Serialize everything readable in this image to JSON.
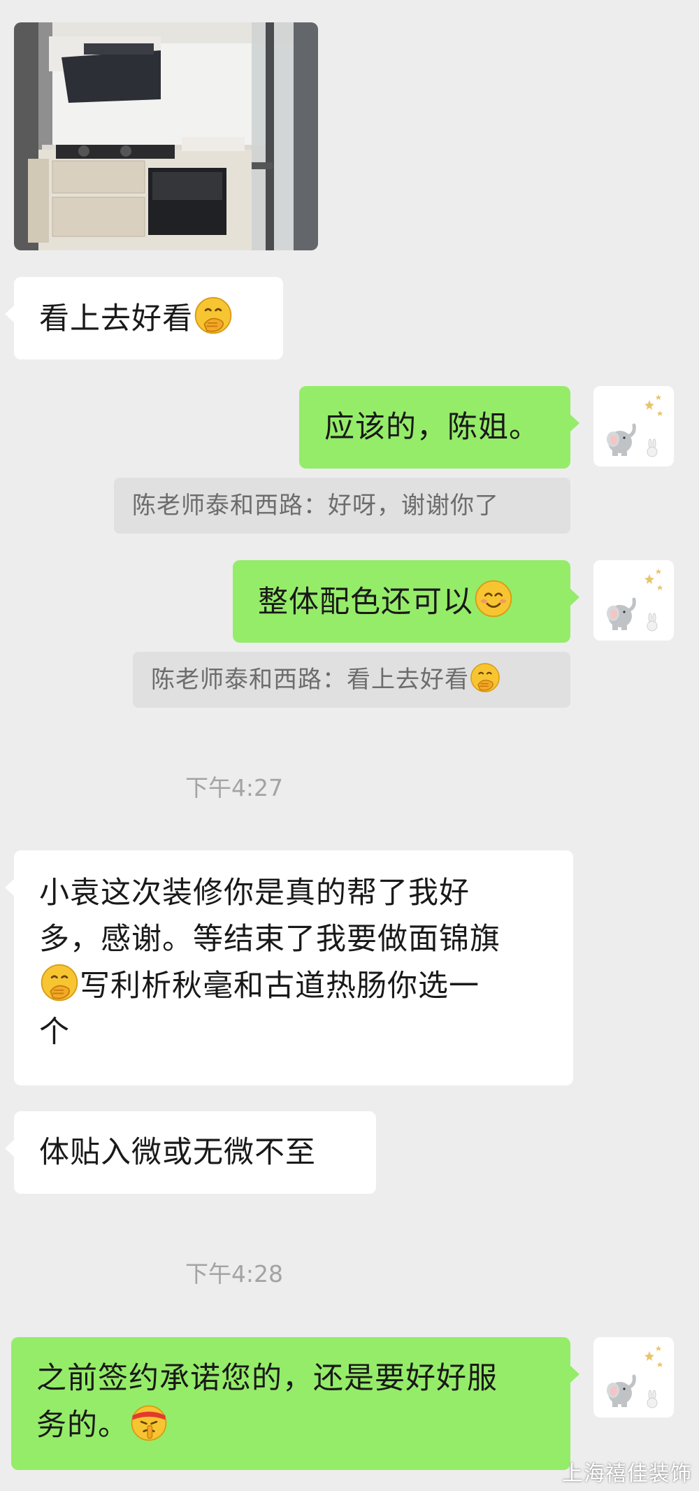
{
  "chat": {
    "photo": {
      "alt": "kitchen-photo"
    },
    "messages": {
      "m1": {
        "text": "看上去好看"
      },
      "m2": {
        "text": "应该的，陈姐。"
      },
      "q1": {
        "text": "陈老师泰和西路：好呀，谢谢你了"
      },
      "m3": {
        "text": "整体配色还可以"
      },
      "q2": {
        "text": "陈老师泰和西路：看上去好看"
      },
      "t1": {
        "text": "下午4:27"
      },
      "m4": {
        "line1": "小袁这次装修你是真的帮了我好",
        "line2": "多，感谢。等结束了我要做面锦旗",
        "line3": "写利析秋毫和古道热肠你选一",
        "line4": "个"
      },
      "m5": {
        "text": "体贴入微或无微不至"
      },
      "t2": {
        "text": "下午4:28"
      },
      "m6": {
        "line1": "之前签约承诺您的，还是要好好服",
        "line2": "务的。"
      }
    },
    "watermark": "上海禧佳装饰"
  },
  "icons": {
    "emoji_thinking": "hand-over-mouth-emoji-icon",
    "emoji_smile": "smiling-face-emoji-icon",
    "emoji_shush": "headband-shushing-emoji-icon",
    "avatar": "elephant-avatar-icon"
  },
  "colors": {
    "background": "#ededed",
    "bubble_self": "#95ec69",
    "bubble_other": "#ffffff",
    "quote_bg": "#e0e0e0",
    "timestamp": "#a3a3a3"
  }
}
